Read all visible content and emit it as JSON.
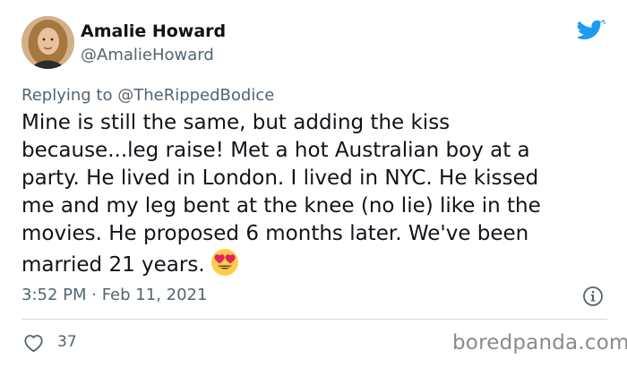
{
  "author": {
    "display_name": "Amalie Howard",
    "handle": "@AmalieHoward"
  },
  "reply": {
    "prefix": "Replying to",
    "to_handle": "@TheRippedBodice"
  },
  "tweet": {
    "lines": [
      "Mine is still the same, but adding the kiss",
      "because...leg raise! Met a hot Australian boy at a",
      "party. He lived in London. I lived in NYC. He kissed",
      "me and my leg bent at the knee (no lie) like in the",
      "movies. He proposed 6 months later. We've been",
      "married 21 years."
    ],
    "emoji": "heart-eyes-emoji",
    "timestamp": "3:52 PM · Feb 11, 2021"
  },
  "stats": {
    "likes": "37"
  },
  "watermark": "boredpanda.com",
  "icons": {
    "brand": "twitter-bird-icon",
    "info": "info-icon",
    "like": "heart-icon"
  },
  "colors": {
    "twitter_blue": "#1d9bf0",
    "text": "#0f1419",
    "secondary": "#536471",
    "divider": "#cfd9de",
    "watermark": "#8a8a8a"
  }
}
